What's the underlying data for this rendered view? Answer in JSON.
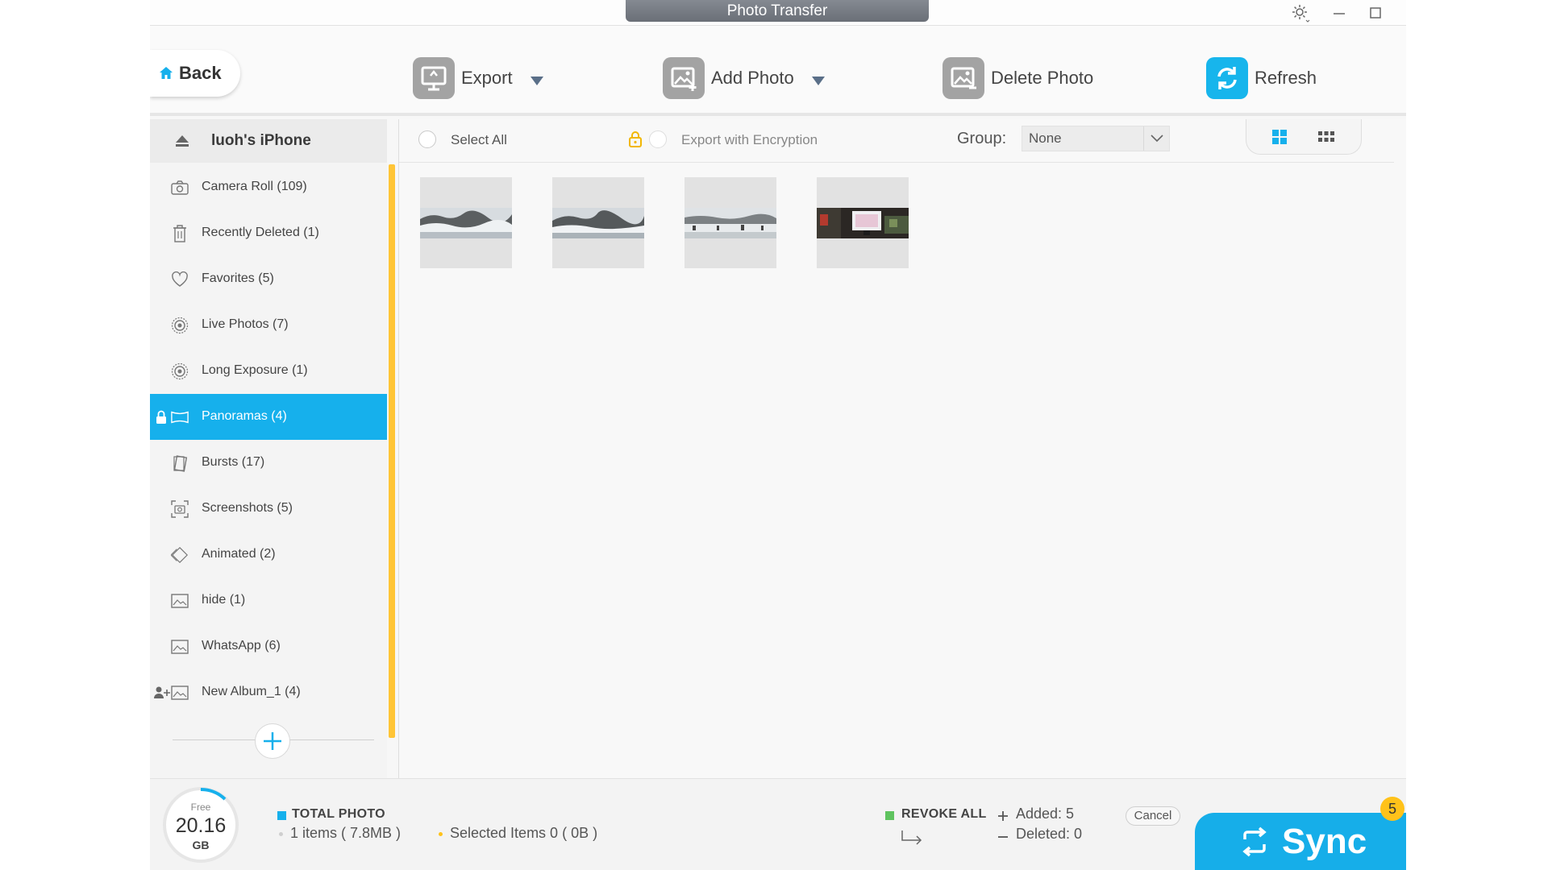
{
  "window": {
    "title": "Photo Transfer"
  },
  "toolbar": {
    "back_label": "Back",
    "export_label": "Export",
    "add_photo_label": "Add Photo",
    "delete_photo_label": "Delete Photo",
    "refresh_label": "Refresh"
  },
  "sidebar": {
    "device_name": "luoh's iPhone",
    "albums": [
      {
        "label": "Camera Roll (109)",
        "icon": "camera-icon"
      },
      {
        "label": "Recently Deleted (1)",
        "icon": "trash-icon"
      },
      {
        "label": "Favorites (5)",
        "icon": "heart-icon"
      },
      {
        "label": "Live Photos (7)",
        "icon": "live-photo-icon"
      },
      {
        "label": "Long Exposure (1)",
        "icon": "live-photo-icon"
      },
      {
        "label": "Panoramas (4)",
        "icon": "panorama-icon",
        "selected": true
      },
      {
        "label": "Bursts (17)",
        "icon": "burst-icon"
      },
      {
        "label": "Screenshots (5)",
        "icon": "screenshot-icon"
      },
      {
        "label": "Animated (2)",
        "icon": "animated-icon"
      },
      {
        "label": "hide (1)",
        "icon": "album-icon"
      },
      {
        "label": "WhatsApp (6)",
        "icon": "album-icon"
      },
      {
        "label": "New Album_1 (4)",
        "icon": "album-icon"
      }
    ]
  },
  "content": {
    "select_all_label": "Select All",
    "encryption_label": "Export with Encryption",
    "group_label": "Group:",
    "group_value": "None",
    "photos": [
      {
        "kind": "snow-panorama"
      },
      {
        "kind": "snow-panorama"
      },
      {
        "kind": "snow-panorama"
      },
      {
        "kind": "indoor-panorama"
      }
    ]
  },
  "footer": {
    "storage_free_label": "Free",
    "storage_value": "20.16",
    "storage_unit": "GB",
    "total_photo_label": "TOTAL PHOTO",
    "items_text": "1 items ( 7.8MB )",
    "selected_text": "Selected Items 0 ( 0B )",
    "revoke_label": "REVOKE ALL",
    "added_text": "Added: 5",
    "deleted_text": "Deleted: 0",
    "cancel_label": "Cancel",
    "sync_label": "Sync",
    "sync_badge": "5"
  },
  "colors": {
    "accent": "#16b0ec",
    "scroll_strip": "#ffc537",
    "total_square": "#16b0ec",
    "revoke_square": "#5fc35f",
    "badge": "#ffc21a"
  }
}
